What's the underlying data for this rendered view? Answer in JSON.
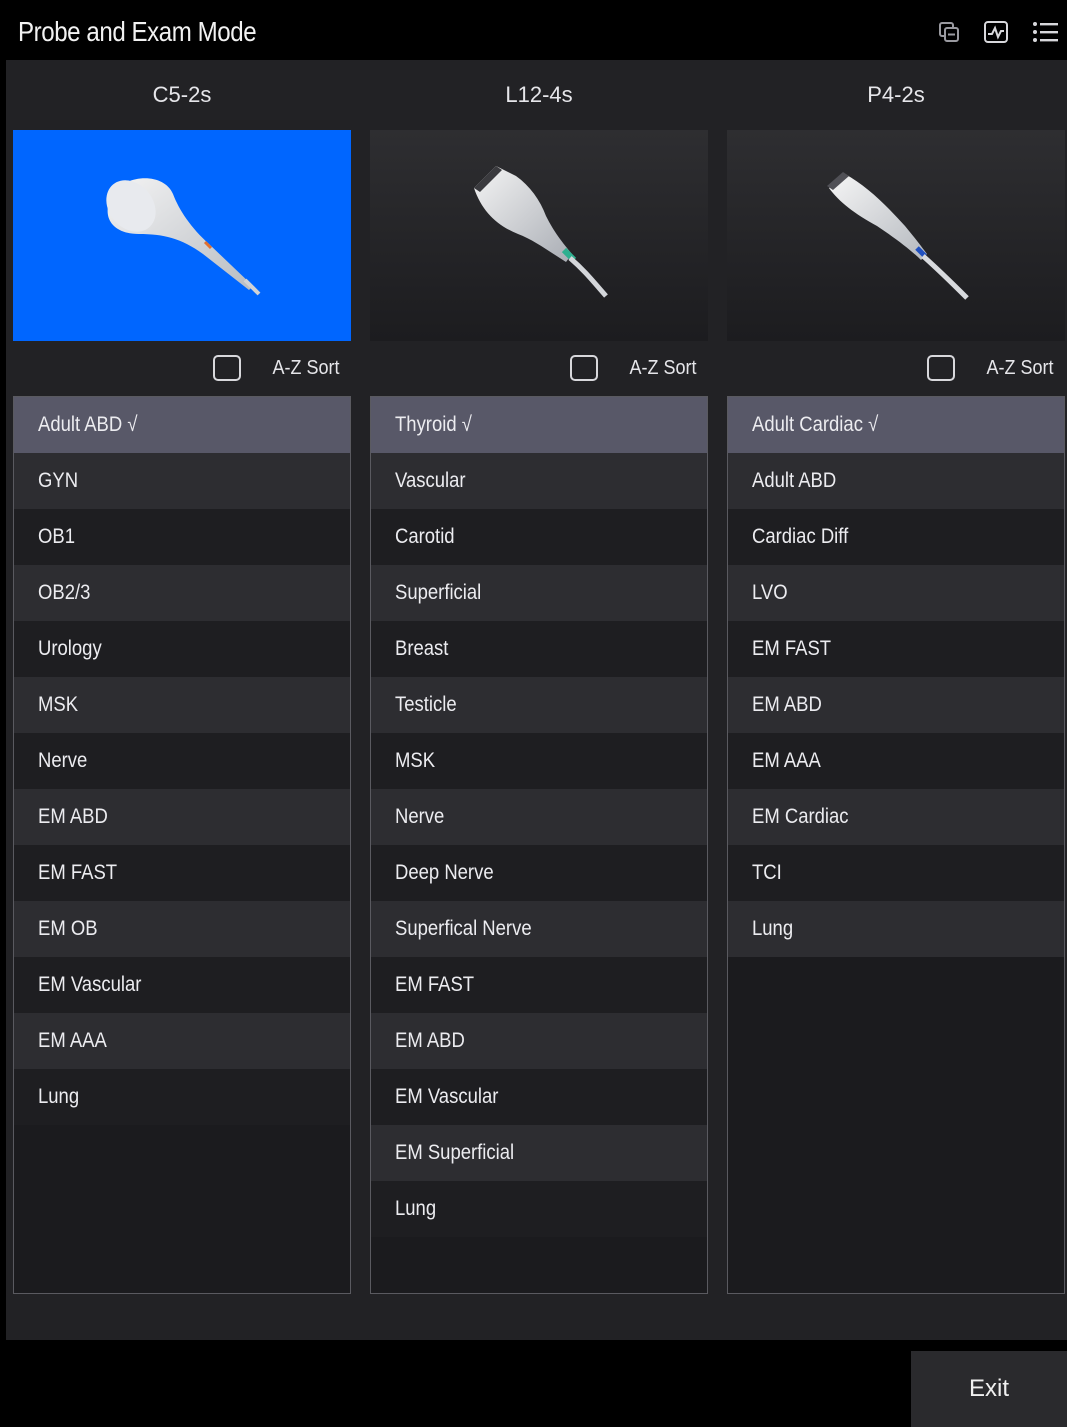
{
  "header": {
    "title": "Probe and Exam Mode",
    "icons": [
      "window-switch-icon",
      "waveform-image-icon",
      "menu-list-icon"
    ]
  },
  "colors": {
    "selected_probe": "#0066ff",
    "selected_row": "#585868",
    "panel": "#222225"
  },
  "probes": [
    {
      "name": "C5-2s",
      "selected": true,
      "sort_label": "A-Z Sort",
      "sort_checked": false,
      "exams": [
        "Adult ABD √",
        "GYN",
        "OB1",
        "OB2/3",
        "Urology",
        "MSK",
        "Nerve",
        "EM ABD",
        "EM FAST",
        "EM OB",
        "EM Vascular",
        "EM AAA",
        "Lung"
      ],
      "selected_exam_index": 0
    },
    {
      "name": "L12-4s",
      "selected": false,
      "sort_label": "A-Z Sort",
      "sort_checked": false,
      "exams": [
        "Thyroid √",
        "Vascular",
        "Carotid",
        "Superficial",
        "Breast",
        "Testicle",
        "MSK",
        "Nerve",
        "Deep Nerve",
        "Superfical Nerve",
        "EM FAST",
        "EM ABD",
        "EM Vascular",
        "EM Superficial",
        "Lung"
      ],
      "selected_exam_index": 0
    },
    {
      "name": "P4-2s",
      "selected": false,
      "sort_label": "A-Z Sort",
      "sort_checked": false,
      "exams": [
        "Adult Cardiac √",
        "Adult ABD",
        "Cardiac Diff",
        "LVO",
        "EM FAST",
        "EM ABD",
        "EM AAA",
        "EM Cardiac",
        "TCI",
        "Lung"
      ],
      "selected_exam_index": 0
    }
  ],
  "footer": {
    "exit_label": "Exit"
  }
}
